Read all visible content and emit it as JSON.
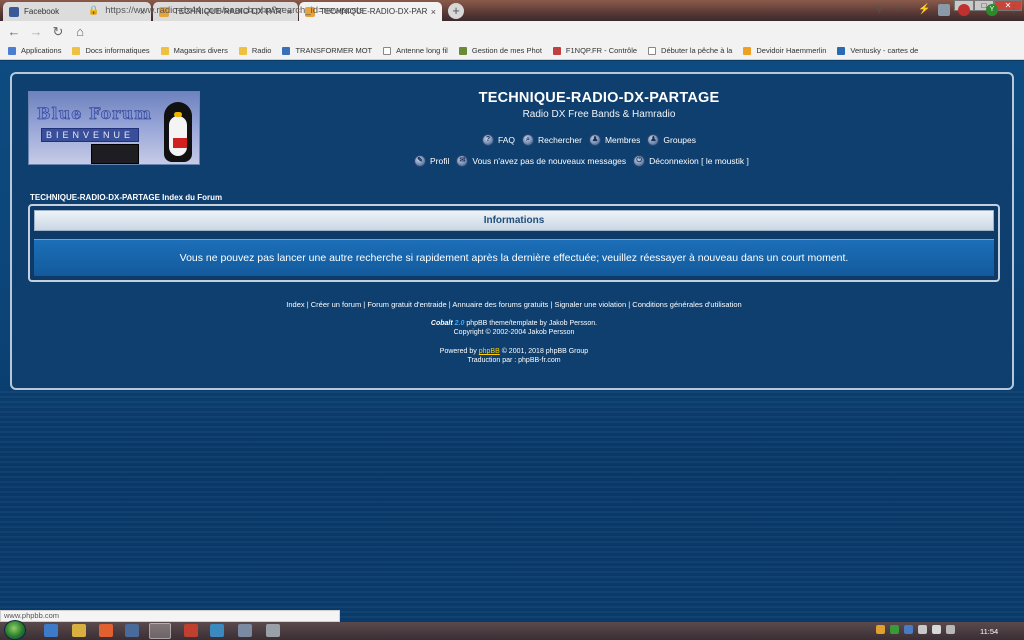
{
  "browser": {
    "tabs": [
      {
        "title": "Facebook",
        "favicon_color": "#3b5998",
        "active": false
      },
      {
        "title": "TECHNIQUE-RADIO-DX-PARTAGE",
        "favicon_color": "#e8a33a",
        "active": false
      },
      {
        "title": "TECHNIQUE-RADIO-DX-PARTAGE",
        "favicon_color": "#e8a33a",
        "active": true
      }
    ],
    "close_glyph": "×",
    "new_tab_glyph": "+",
    "url": "https://www.radio-dx44.com/search.php?search_id=newposts",
    "bookmarks": [
      {
        "label": "Applications",
        "color": "#4a7ed0"
      },
      {
        "label": "Docs informatiques",
        "color": "#f0c040"
      },
      {
        "label": "Magasins divers",
        "color": "#f0c040"
      },
      {
        "label": "Radio",
        "color": "#f0c040"
      },
      {
        "label": "TRANSFORMER MOT",
        "color": "#3a6fb8"
      },
      {
        "label": "Antenne long fil",
        "color": "#ffffff"
      },
      {
        "label": "Gestion de mes Phot",
        "color": "#6a8a3a"
      },
      {
        "label": "F1NQP.FR - Contrôle",
        "color": "#c04040"
      },
      {
        "label": "Débuter la pêche à la",
        "color": "#ffffff"
      },
      {
        "label": "Devidoir Haemmerlin",
        "color": "#f0a020"
      },
      {
        "label": "Ventusky - cartes de",
        "color": "#2a6ab0"
      }
    ],
    "status_url": "www.phpbb.com"
  },
  "forum": {
    "logo_text": "Blue Forum",
    "logo_subtext": "BIENVENUE",
    "site_title": "TECHNIQUE-RADIO-DX-PARTAGE",
    "site_description": "Radio DX Free Bands & Hamradio",
    "nav_row1": [
      {
        "label": "FAQ",
        "icon": "faq-icon",
        "glyph": "?"
      },
      {
        "label": "Rechercher",
        "icon": "search-icon",
        "glyph": "⌕"
      },
      {
        "label": "Membres",
        "icon": "members-icon",
        "glyph": "♟"
      },
      {
        "label": "Groupes",
        "icon": "groups-icon",
        "glyph": "♟"
      }
    ],
    "nav_row2": [
      {
        "label": "Profil",
        "icon": "profile-icon",
        "glyph": "✎"
      },
      {
        "label": "Vous n'avez pas de nouveaux messages",
        "icon": "messages-icon",
        "glyph": "✉"
      },
      {
        "label": "Déconnexion [ le moustik ]",
        "icon": "logout-icon",
        "glyph": "⏻"
      }
    ],
    "breadcrumb": "TECHNIQUE-RADIO-DX-PARTAGE Index du Forum",
    "info_title": "Informations",
    "info_message": "Vous ne pouvez pas lancer une autre recherche si rapidement après la dernière effectuée; veuillez réessayer à nouveau dans un court moment.",
    "footer_links": [
      "Index",
      "Créer un forum",
      "Forum gratuit d'entraide",
      "Annuaire des forums gratuits",
      "Signaler une violation",
      "Conditions générales d'utilisation"
    ],
    "footer_separator": " | ",
    "credit_theme_name": "Cobalt",
    "credit_theme_version": "2.0",
    "credit_theme_rest": " phpBB theme/template by Jakob Persson.",
    "credit_copyright": "Copyright © 2002-2004 Jakob Persson",
    "credit_powered_prefix": "Powered by ",
    "credit_powered_link": "phpBB",
    "credit_powered_suffix": " © 2001, 2018 phpBB Group",
    "credit_translation": "Traduction par : phpBB-fr.com"
  },
  "taskbar": {
    "clock": "11:54"
  }
}
